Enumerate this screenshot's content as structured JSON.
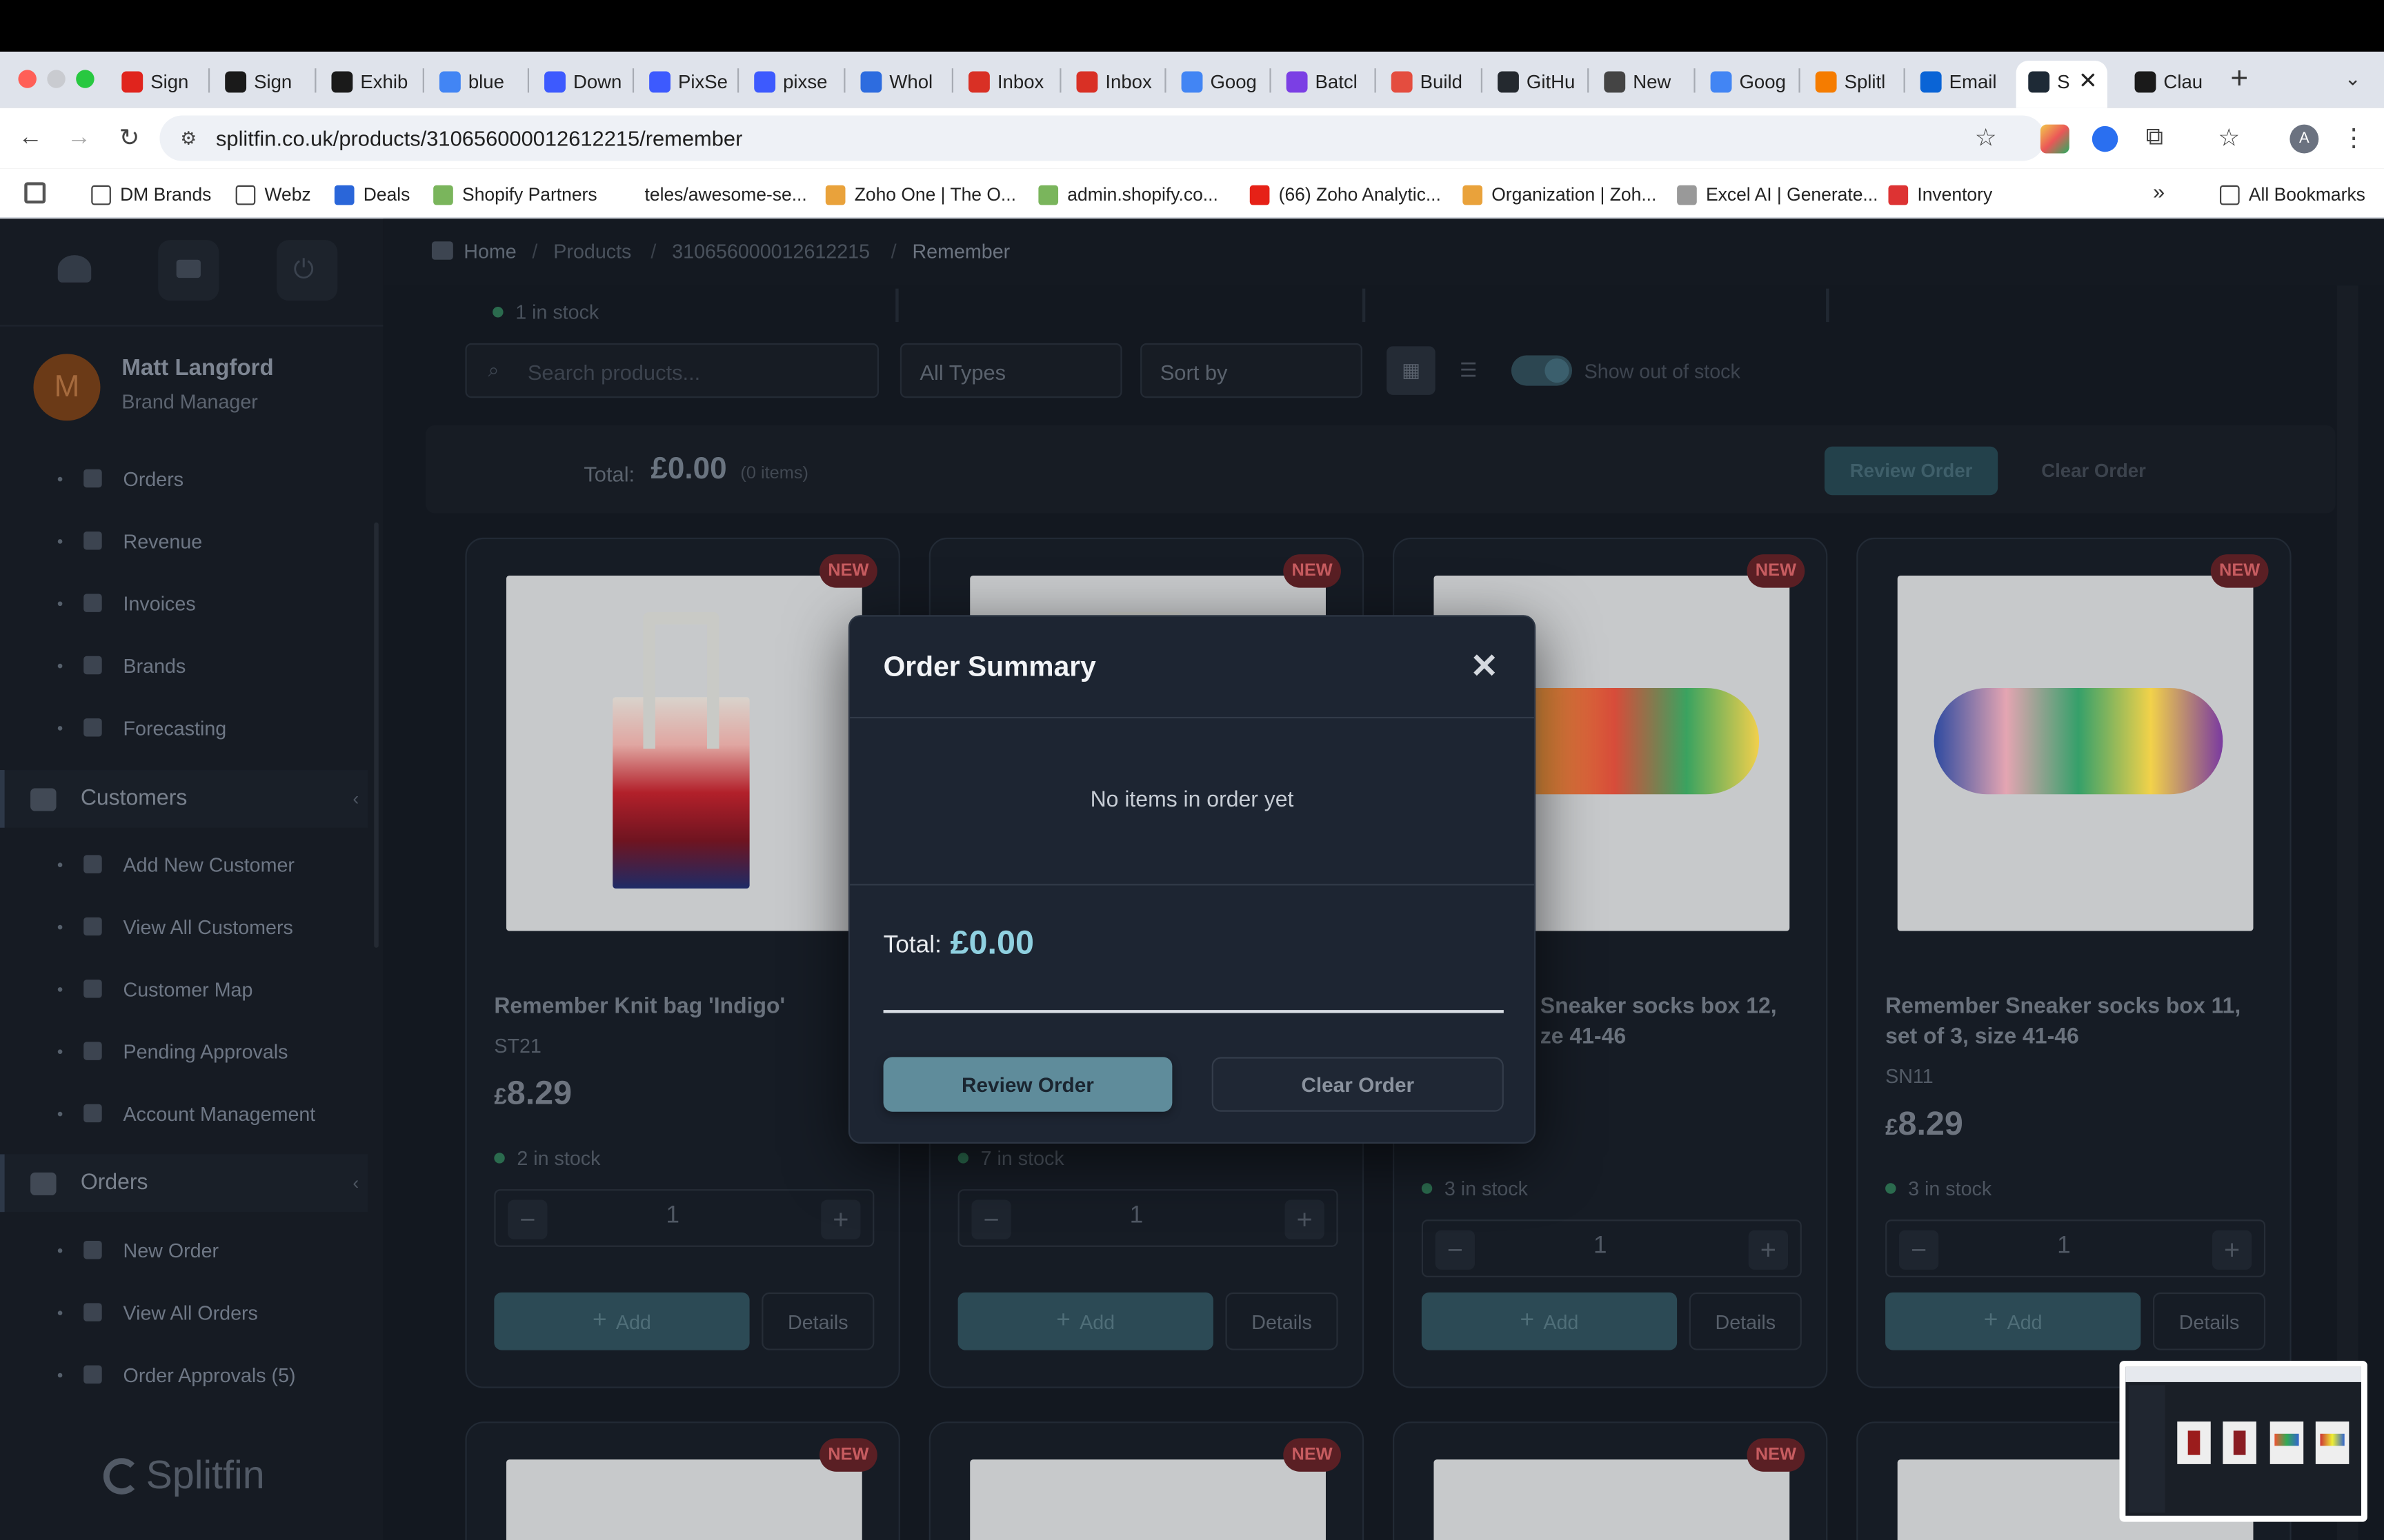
{
  "browser": {
    "tabs": [
      {
        "label": "Sign",
        "icon": "adobe-icon",
        "color": "#e0241d"
      },
      {
        "label": "Sign",
        "icon": "docusign-icon",
        "color": "#1a1a1a"
      },
      {
        "label": "Exhib",
        "icon": "af-icon",
        "color": "#1a1a1a"
      },
      {
        "label": "blue",
        "icon": "google-icon",
        "color": "#4285f4"
      },
      {
        "label": "Down",
        "icon": "app-icon",
        "color": "#3d5afe"
      },
      {
        "label": "PixSe",
        "icon": "app-icon",
        "color": "#3d5afe"
      },
      {
        "label": "pixse",
        "icon": "app-icon",
        "color": "#3d5afe"
      },
      {
        "label": "Whol",
        "icon": "dolphin-icon",
        "color": "#2d6cdf"
      },
      {
        "label": "Inbox",
        "icon": "gmail-icon",
        "color": "#d93025"
      },
      {
        "label": "Inbox",
        "icon": "gmail-icon",
        "color": "#d93025"
      },
      {
        "label": "Goog",
        "icon": "google-icon",
        "color": "#4285f4"
      },
      {
        "label": "Batcl",
        "icon": "batch-icon",
        "color": "#7b3fe4"
      },
      {
        "label": "Build",
        "icon": "build-icon",
        "color": "#e44d3f"
      },
      {
        "label": "GitHu",
        "icon": "github-icon",
        "color": "#24292f"
      },
      {
        "label": "New",
        "icon": "chrome-icon",
        "color": "#444444"
      },
      {
        "label": "Goog",
        "icon": "google-icon",
        "color": "#4285f4"
      },
      {
        "label": "Splitl",
        "icon": "fire-icon",
        "color": "#f57c00"
      },
      {
        "label": "Email",
        "icon": "outlook-icon",
        "color": "#0a64d6"
      },
      {
        "label": "S",
        "icon": "splitfin-icon",
        "color": "#1e2a36"
      },
      {
        "label": "Clau",
        "icon": "anthropic-icon",
        "color": "#1a1a1a"
      }
    ],
    "url": "splitfin.co.uk/products/310656000012612215/remember",
    "bookmarks": [
      {
        "label": "DM Brands",
        "icon": "folder-icon"
      },
      {
        "label": "Webz",
        "icon": "folder-icon"
      },
      {
        "label": "Deals",
        "icon": "deals-icon"
      },
      {
        "label": "Shopify Partners",
        "icon": "shopify-icon"
      },
      {
        "label": "teles/awesome-se...",
        "icon": "github-icon"
      },
      {
        "label": "Zoho One | The O...",
        "icon": "zoho-icon"
      },
      {
        "label": "admin.shopify.co...",
        "icon": "shopify-icon"
      },
      {
        "label": "(66) Zoho Analytic...",
        "icon": "youtube-icon"
      },
      {
        "label": "Organization | Zoh...",
        "icon": "zoho-icon"
      },
      {
        "label": "Excel AI | Generate...",
        "icon": "excel-ai-icon"
      },
      {
        "label": "Inventory",
        "icon": "inventory-icon"
      }
    ],
    "all_bookmarks": "All Bookmarks",
    "more": "»",
    "profile_initial": "A"
  },
  "sidebar": {
    "user_name": "Matt Langford",
    "user_role": "Brand Manager",
    "avatar_initial": "M",
    "items_top": [
      "Orders",
      "Revenue",
      "Invoices",
      "Brands",
      "Forecasting"
    ],
    "customers_header": "Customers",
    "customers_items": [
      "Add New Customer",
      "View All Customers",
      "Customer Map",
      "Pending Approvals",
      "Account Management"
    ],
    "orders_header": "Orders",
    "orders_items": [
      "New Order",
      "View All Orders",
      "Order Approvals (5)"
    ],
    "logo": "Splitfin"
  },
  "breadcrumb": [
    "Home",
    "Products",
    "310656000012612215",
    "Remember"
  ],
  "top_stock": "1 in stock",
  "filters": {
    "search_placeholder": "Search products...",
    "types": "All Types",
    "sort": "Sort by",
    "show_out_of_stock": "Show out of stock"
  },
  "order_bar": {
    "total_label": "Total:",
    "total_value": "£0.00",
    "items": "(0 items)",
    "review": "Review Order",
    "clear": "Clear Order"
  },
  "products": [
    {
      "title": "Remember Knit bag 'Indigo'",
      "sku": "ST21",
      "price": "8.29",
      "currency": "£",
      "stock": "2 in stock",
      "qty": "1",
      "badge": "NEW"
    },
    {
      "title": "",
      "sku": "",
      "price": "",
      "currency": "",
      "stock": "7 in stock",
      "qty": "1",
      "badge": "NEW"
    },
    {
      "title": "Sneaker socks box 12,\nze 41-46",
      "sku": "",
      "price": "",
      "currency": "",
      "stock": "3 in stock",
      "qty": "1",
      "badge": "NEW"
    },
    {
      "title": "Remember Sneaker socks box 11, set of 3, size 41-46",
      "sku": "SN11",
      "price": "8.29",
      "currency": "£",
      "stock": "3 in stock",
      "qty": "1",
      "badge": "NEW"
    }
  ],
  "card_buttons": {
    "add": "Add",
    "details": "Details"
  },
  "bottom_badges": [
    "NEW",
    "NEW",
    "NEW"
  ],
  "modal": {
    "title": "Order Summary",
    "empty": "No items in order yet",
    "total_label": "Total:",
    "total_value": "£0.00",
    "review": "Review Order",
    "clear": "Clear Order"
  }
}
